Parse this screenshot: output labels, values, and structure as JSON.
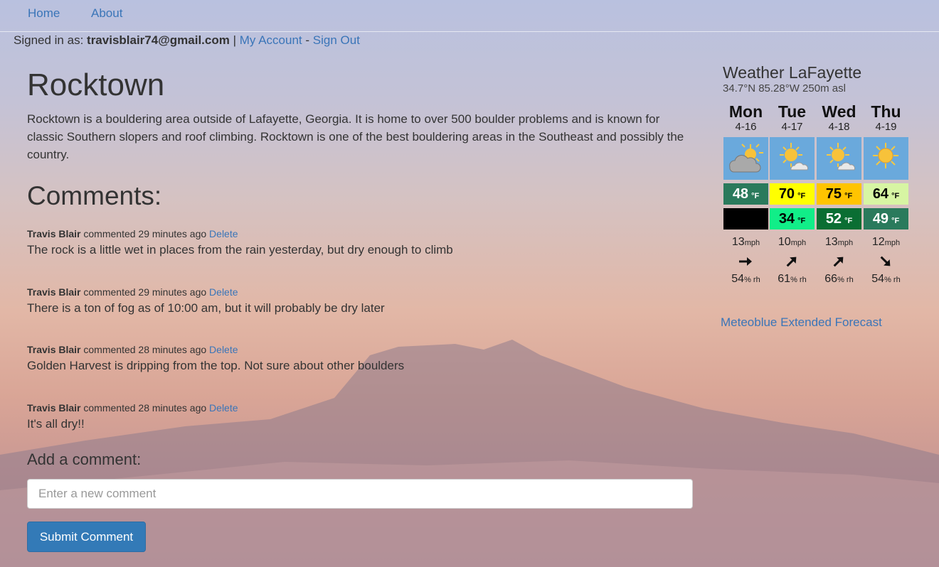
{
  "nav": {
    "home": "Home",
    "about": "About"
  },
  "account": {
    "prefix": "Signed in as:",
    "email": "travisblair74@gmail.com",
    "sep1": "|",
    "my_account": "My Account",
    "sep2": "-",
    "sign_out": "Sign Out"
  },
  "area": {
    "title": "Rocktown",
    "description": "Rocktown is a bouldering area outside of Lafayette, Georgia. It is home to over 500 boulder problems and is known for classic Southern slopers and roof climbing. Rocktown is one of the best bouldering areas in the Southeast and possibly the country."
  },
  "comments": {
    "heading": "Comments:",
    "items": [
      {
        "author": "Travis Blair",
        "meta": "commented 29 minutes ago",
        "delete": "Delete",
        "text": "The rock is a little wet in places from the rain yesterday, but dry enough to climb"
      },
      {
        "author": "Travis Blair",
        "meta": "commented 29 minutes ago",
        "delete": "Delete",
        "text": "There is a ton of fog as of 10:00 am, but it will probably be dry later"
      },
      {
        "author": "Travis Blair",
        "meta": "commented 28 minutes ago",
        "delete": "Delete",
        "text": "Golden Harvest is dripping from the top. Not sure about other boulders"
      },
      {
        "author": "Travis Blair",
        "meta": "commented 28 minutes ago",
        "delete": "Delete",
        "text": "It's all dry!!"
      }
    ],
    "add_label": "Add a comment:",
    "input_placeholder": "Enter a new comment",
    "submit": "Submit Comment"
  },
  "weather": {
    "title": "Weather LaFayette",
    "coords": "34.7°N 85.28°W 250m asl",
    "unit": "°F",
    "wind_unit": "mph",
    "hum_unit": "% rh",
    "days": [
      {
        "day": "Mon",
        "date": "4-16",
        "icon": "partly-cloudy-icon",
        "high": "48",
        "high_bg": "#2a7a5c",
        "high_fg": "#ffffff",
        "low": "",
        "low_bg": "#000000",
        "low_fg": "#ffffff",
        "wind": "13",
        "wind_dir": "east-arrow-icon",
        "humidity": "54"
      },
      {
        "day": "Tue",
        "date": "4-17",
        "icon": "sun-cloud-icon",
        "high": "70",
        "high_bg": "#ffff00",
        "high_fg": "#000000",
        "low": "34",
        "low_bg": "#11ee88",
        "low_fg": "#000000",
        "wind": "10",
        "wind_dir": "northeast-arrow-icon",
        "humidity": "61"
      },
      {
        "day": "Wed",
        "date": "4-18",
        "icon": "sun-cloud-icon",
        "high": "75",
        "high_bg": "#ffc400",
        "high_fg": "#000000",
        "low": "52",
        "low_bg": "#0a6e33",
        "low_fg": "#ffffff",
        "wind": "13",
        "wind_dir": "northeast-arrow-icon",
        "humidity": "66"
      },
      {
        "day": "Thu",
        "date": "4-19",
        "icon": "sun-icon",
        "high": "64",
        "high_bg": "#d7f5a3",
        "high_fg": "#000000",
        "low": "49",
        "low_bg": "#2a7a5c",
        "low_fg": "#ffffff",
        "wind": "12",
        "wind_dir": "southeast-arrow-icon",
        "humidity": "54"
      }
    ],
    "extended_link": "Meteoblue Extended Forecast"
  }
}
